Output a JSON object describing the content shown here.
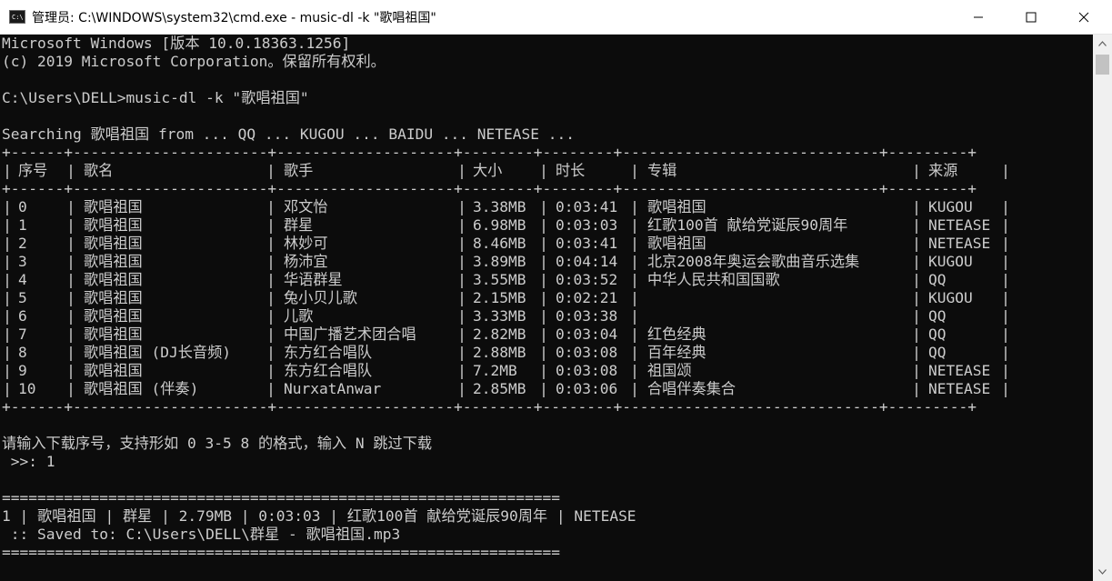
{
  "window": {
    "title": "管理员: C:\\WINDOWS\\system32\\cmd.exe - music-dl  -k \"歌唱祖国\"",
    "icon_glyph": "C:\\"
  },
  "console": {
    "header_lines": [
      "Microsoft Windows [版本 10.0.18363.1256]",
      "(c) 2019 Microsoft Corporation。保留所有权利。",
      "",
      "C:\\Users\\DELL>music-dl -k \"歌唱祖国\"",
      "",
      "Searching 歌唱祖国 from ... QQ ... KUGOU ... BAIDU ... NETEASE ..."
    ],
    "table": {
      "border_top": "+------+----------------------+--------------------+--------+--------+-----------------------------+---------+",
      "headers": [
        "序号",
        "歌名",
        "歌手",
        "大小",
        "时长",
        "专辑",
        "来源"
      ],
      "rows": [
        [
          "0",
          "歌唱祖国",
          "邓文怡",
          "3.38MB",
          "0:03:41",
          "歌唱祖国",
          "KUGOU"
        ],
        [
          "1",
          "歌唱祖国",
          "群星",
          "6.98MB",
          "0:03:03",
          "红歌100首 献给党诞辰90周年",
          "NETEASE"
        ],
        [
          "2",
          "歌唱祖国",
          "林妙可",
          "8.46MB",
          "0:03:41",
          "歌唱祖国",
          "NETEASE"
        ],
        [
          "3",
          "歌唱祖国",
          "杨沛宜",
          "3.89MB",
          "0:04:14",
          "北京2008年奥运会歌曲音乐选集",
          "KUGOU"
        ],
        [
          "4",
          "歌唱祖国",
          "华语群星",
          "3.55MB",
          "0:03:52",
          "中华人民共和国国歌",
          "QQ"
        ],
        [
          "5",
          "歌唱祖国",
          "兔小贝儿歌",
          "2.15MB",
          "0:02:21",
          "",
          "KUGOU"
        ],
        [
          "6",
          "歌唱祖国",
          "儿歌",
          "3.33MB",
          "0:03:38",
          "",
          "QQ"
        ],
        [
          "7",
          "歌唱祖国",
          "中国广播艺术团合唱",
          "2.82MB",
          "0:03:04",
          "红色经典",
          "QQ"
        ],
        [
          "8",
          "歌唱祖国 (DJ长音频)",
          "东方红合唱队",
          "2.88MB",
          "0:03:08",
          "百年经典",
          "QQ"
        ],
        [
          "9",
          "歌唱祖国",
          "东方红合唱队",
          "7.2MB",
          "0:03:08",
          "祖国颂",
          "NETEASE"
        ],
        [
          "10",
          "歌唱祖国 (伴奏)",
          "NurxatAnwar",
          "2.85MB",
          "0:03:06",
          "合唱伴奏集合",
          "NETEASE"
        ]
      ]
    },
    "prompt_line": "请输入下载序号，支持形如 0 3-5 8 的格式，输入 N 跳过下载",
    "input_line": " >>: 1",
    "separator": "===============================================================",
    "result_line": "1 | 歌唱祖国 | 群星 | 2.79MB | 0:03:03 | 红歌100首 献给党诞辰90周年 | NETEASE",
    "saved_line": " :: Saved to: C:\\Users\\DELL\\群星 - 歌唱祖国.mp3"
  },
  "colors": {
    "console_bg": "#0c0c0c",
    "console_fg": "#cccccc",
    "titlebar_bg": "#ffffff",
    "scrollbar_bg": "#f0f0f0"
  }
}
